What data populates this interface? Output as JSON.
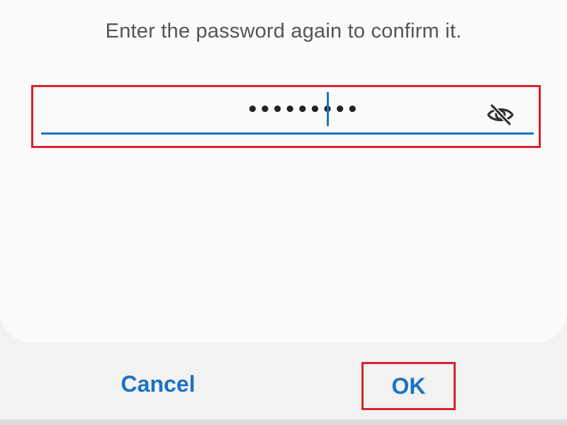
{
  "dialog": {
    "prompt": "Enter the password again to confirm it.",
    "password_field": {
      "masked_value": "•••••••••",
      "toggle_icon": "eye-off-icon",
      "underline_color": "#1a73c4"
    },
    "buttons": {
      "cancel_label": "Cancel",
      "ok_label": "OK"
    }
  },
  "colors": {
    "accent": "#1a73c4",
    "highlight": "#d9232d",
    "prompt_text": "#555555"
  }
}
